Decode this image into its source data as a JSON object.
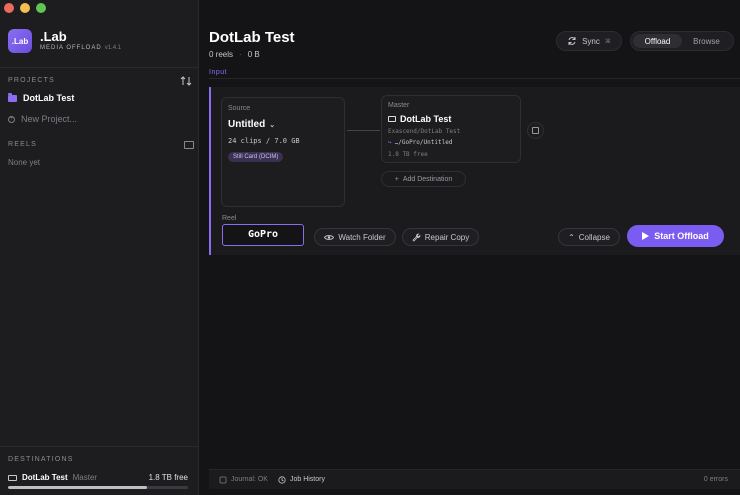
{
  "app": {
    "name": ".Lab",
    "logo_text": ".Lab",
    "subtitle": "MEDIA OFFLOAD",
    "version": "v1.4.1"
  },
  "sidebar": {
    "projects_label": "PROJECTS",
    "projects": [
      {
        "label": "DotLab Test",
        "active": true
      },
      {
        "label": "New Project..."
      }
    ],
    "reels_label": "REELS",
    "reels_empty": "None yet",
    "destinations_label": "DESTINATIONS",
    "destination": {
      "name": "DotLab Test",
      "role": "Master",
      "free": "1.8 TB free",
      "usage_fraction": 0.77
    }
  },
  "header": {
    "title": "DotLab Test",
    "reels": "0 reels",
    "size": "0 B",
    "sync_label": "Sync",
    "sync_shortcut": "⌘",
    "tabs": [
      {
        "label": "Offload",
        "active": true
      },
      {
        "label": "Browse"
      }
    ]
  },
  "input": {
    "section_label": "Input",
    "source": {
      "label": "Source",
      "name": "Untitled",
      "clips": "24 clips / 7.0 GB",
      "badge": "Still Card (DCIM)"
    },
    "master": {
      "label": "Master",
      "name": "DotLab Test",
      "path": "Exascend/DotLab Test",
      "subpath": "…/GoPro/Untitled",
      "free": "1.8 TB free"
    },
    "add_destination": "Add Destination",
    "reel_label": "Reel",
    "reel_value": "GoPro",
    "watch_folder": "Watch Folder",
    "repair_copy": "Repair Copy",
    "collapse": "Collapse",
    "start": "Start Offload"
  },
  "footer": {
    "journal": "Journal: OK",
    "job_history": "Job History",
    "errors": "0 errors"
  },
  "colors": {
    "accent": "#7b5cf0",
    "background": "#141416",
    "sidebar": "#1d1d20"
  }
}
